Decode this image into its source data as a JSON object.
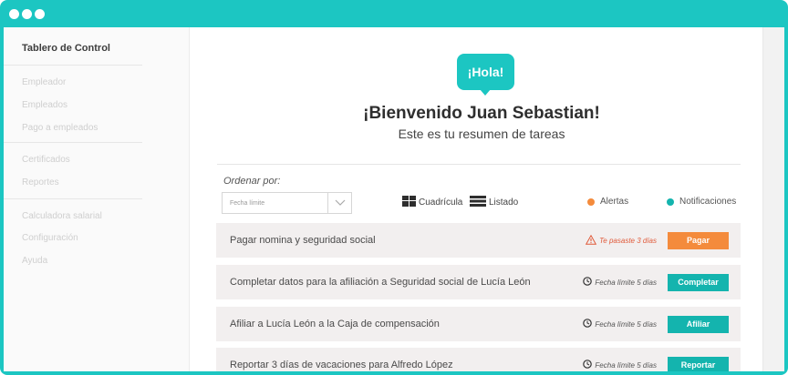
{
  "sidebar": {
    "title": "Tablero de Control",
    "groups": [
      [
        "Empleador",
        "Empleados",
        "Pago a empleados"
      ],
      [
        "Certificados",
        "Reportes"
      ],
      [
        "Calculadora salarial",
        "Configuración",
        "Ayuda"
      ]
    ]
  },
  "greeting": {
    "bubble": "¡Hola!",
    "welcome": "¡Bienvenido Juan Sebastian!",
    "subtitle": "Este es tu resumen de tareas"
  },
  "sort": {
    "label": "Ordenar por:",
    "value": "Fecha límite"
  },
  "views": {
    "grid": "Cuadrícula",
    "list": "Listado"
  },
  "legend": {
    "alerts": "Alertas",
    "notifications": "Notificaciones"
  },
  "colors": {
    "brand": "#1cc6c2",
    "orange": "#f48b3c",
    "teal_button": "#14b4ae",
    "alert_red": "#e05a3a"
  },
  "tasks": [
    {
      "title": "Pagar nomina y seguridad social",
      "status": "Te pasaste 3 días",
      "status_icon": "warning-icon",
      "late": true,
      "action": "Pagar",
      "color": "#f48b3c"
    },
    {
      "title": "Completar datos para la afiliación a Seguridad social de Lucía León",
      "status": "Fecha límite 5 días",
      "status_icon": "clock-icon",
      "late": false,
      "action": "Completar",
      "color": "#14b4ae"
    },
    {
      "title": "Afiliar a Lucía León a la Caja de compensación",
      "status": "Fecha límite 5 días",
      "status_icon": "clock-icon",
      "late": false,
      "action": "Afiliar",
      "color": "#14b4ae"
    },
    {
      "title": "Reportar 3 días de vacaciones para Alfredo López",
      "status": "Fecha límite 5 días",
      "status_icon": "clock-icon",
      "late": false,
      "action": "Reportar",
      "color": "#14b4ae"
    }
  ]
}
